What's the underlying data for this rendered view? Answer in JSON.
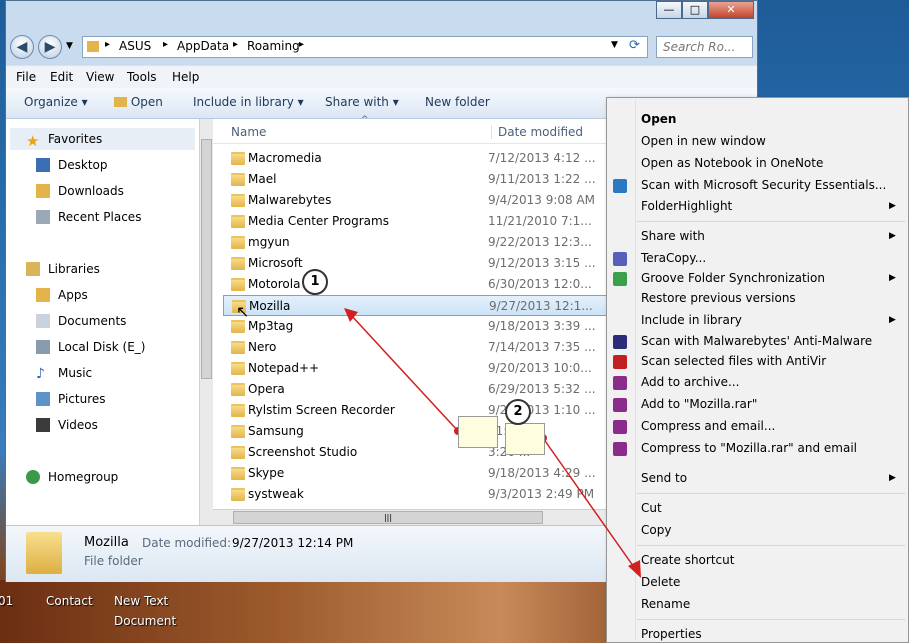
{
  "window": {
    "controls": {
      "minimize": "—",
      "maximize": "□",
      "close": "✕"
    },
    "breadcrumb": [
      "ASUS",
      "AppData",
      "Roaming"
    ],
    "search_placeholder": "Search Ro...",
    "menu": [
      "File",
      "Edit",
      "View",
      "Tools",
      "Help"
    ],
    "toolbar": {
      "organize": "Organize",
      "open": "Open",
      "include": "Include in library",
      "share": "Share with",
      "new_folder": "New folder"
    }
  },
  "nav": {
    "favorites": "Favorites",
    "favorites_items": [
      "Desktop",
      "Downloads",
      "Recent Places"
    ],
    "libraries": "Libraries",
    "libraries_items": [
      "Apps",
      "Documents",
      "Local Disk (E_)",
      "Music",
      "Pictures",
      "Videos"
    ],
    "homegroup": "Homegroup"
  },
  "columns": {
    "name": "Name",
    "date": "Date modified"
  },
  "files": [
    {
      "name": "Macromedia",
      "date": "7/12/2013 4:12 ..."
    },
    {
      "name": "Mael",
      "date": "9/11/2013 1:22 ..."
    },
    {
      "name": "Malwarebytes",
      "date": "9/4/2013 9:08 AM"
    },
    {
      "name": "Media Center Programs",
      "date": "11/21/2010 7:1..."
    },
    {
      "name": "mgyun",
      "date": "9/22/2013 12:3..."
    },
    {
      "name": "Microsoft",
      "date": "9/12/2013 3:15 ..."
    },
    {
      "name": "Motorola",
      "date": "6/30/2013 12:0..."
    },
    {
      "name": "Mozilla",
      "date": "9/27/2013 12:1..."
    },
    {
      "name": "Mp3tag",
      "date": "9/18/2013 3:39 ..."
    },
    {
      "name": "Nero",
      "date": "7/14/2013 7:35 ..."
    },
    {
      "name": "Notepad++",
      "date": "9/20/2013 10:0..."
    },
    {
      "name": "Opera",
      "date": "6/29/2013 5:32 ..."
    },
    {
      "name": "Rylstim Screen Recorder",
      "date": "9/27/2013 1:10 ..."
    },
    {
      "name": "Samsung",
      "date": "11:29 ..."
    },
    {
      "name": "Screenshot Studio",
      "date": "3:26 ..."
    },
    {
      "name": "Skype",
      "date": "9/18/2013 4:29 ..."
    },
    {
      "name": "systweak",
      "date": "9/3/2013 2:49 PM"
    }
  ],
  "details": {
    "name": "Mozilla",
    "date_label": "Date modified:",
    "date": "9/27/2013 12:14 PM",
    "type": "File folder"
  },
  "context_menu": [
    {
      "label": "Open",
      "bold": true
    },
    {
      "label": "Open in new window"
    },
    {
      "label": "Open as Notebook in OneNote"
    },
    {
      "label": "Scan with Microsoft Security Essentials..."
    },
    {
      "label": "FolderHighlight",
      "submenu": true
    },
    {
      "label": "Share with",
      "submenu": true
    },
    {
      "label": "TeraCopy..."
    },
    {
      "label": "Groove Folder Synchronization",
      "submenu": true
    },
    {
      "label": "Restore previous versions"
    },
    {
      "label": "Include in library",
      "submenu": true
    },
    {
      "label": "Scan with Malwarebytes' Anti-Malware"
    },
    {
      "label": "Scan selected files with AntiVir"
    },
    {
      "label": "Add to archive..."
    },
    {
      "label": "Add to \"Mozilla.rar\""
    },
    {
      "label": "Compress and email..."
    },
    {
      "label": "Compress to \"Mozilla.rar\" and email"
    },
    {
      "label": "Send to",
      "submenu": true
    },
    {
      "label": "Cut"
    },
    {
      "label": "Copy"
    },
    {
      "label": "Create shortcut"
    },
    {
      "label": "Delete"
    },
    {
      "label": "Rename"
    },
    {
      "label": "Properties"
    }
  ],
  "desktop_labels": {
    "contact": "Contact",
    "new_text": "New Text",
    "document": "Document",
    "left_fragment": "01"
  },
  "annotations": {
    "step1": "1",
    "step2": "2"
  },
  "colors": {
    "arrow": "#d21f1f",
    "selection": "#cde3f8",
    "folder": "#e2b44b"
  }
}
